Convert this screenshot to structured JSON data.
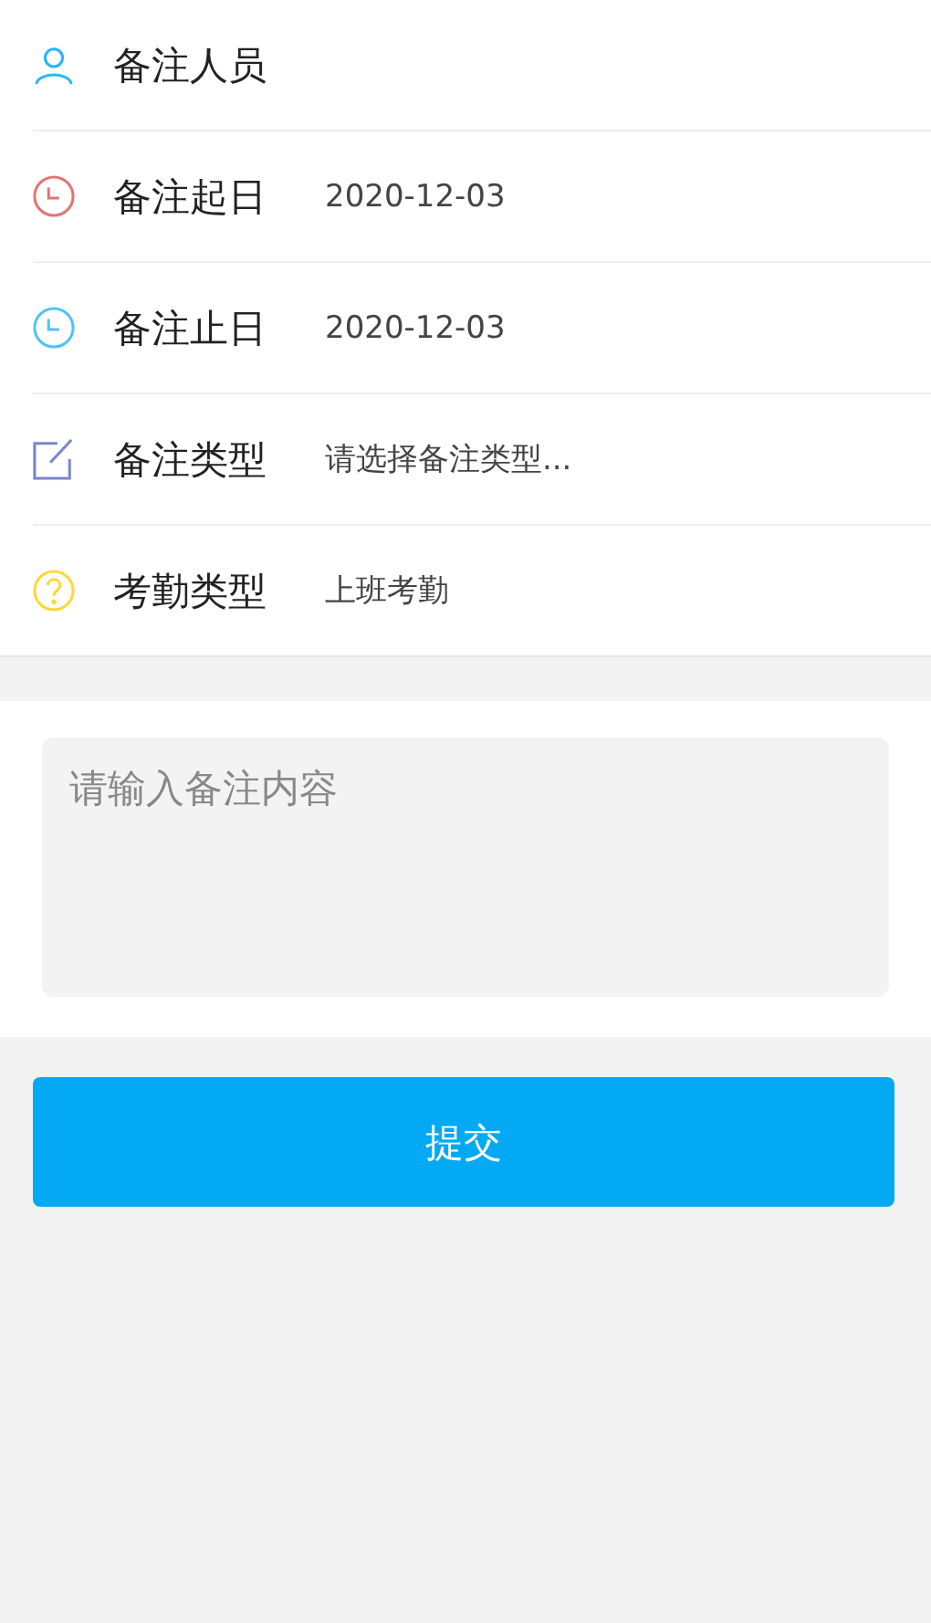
{
  "form_rows": [
    {
      "kind": "person",
      "color": "#29b6f6",
      "label": "备注人员"
    },
    {
      "kind": "clock",
      "color": "#e57373",
      "label": "备注起日",
      "value": "2020-12-03"
    },
    {
      "kind": "clock",
      "color": "#4fc3f7",
      "label": "备注止日",
      "value": "2020-12-03"
    },
    {
      "kind": "edit",
      "color": "#7986cb",
      "label": "备注类型",
      "value": "请选择备注类型..."
    },
    {
      "kind": "question",
      "color": "#fdd835",
      "label": "考勤类型",
      "value": "上班考勤"
    }
  ],
  "remark": {
    "placeholder": "请输入备注内容"
  },
  "submit_button": "提交"
}
